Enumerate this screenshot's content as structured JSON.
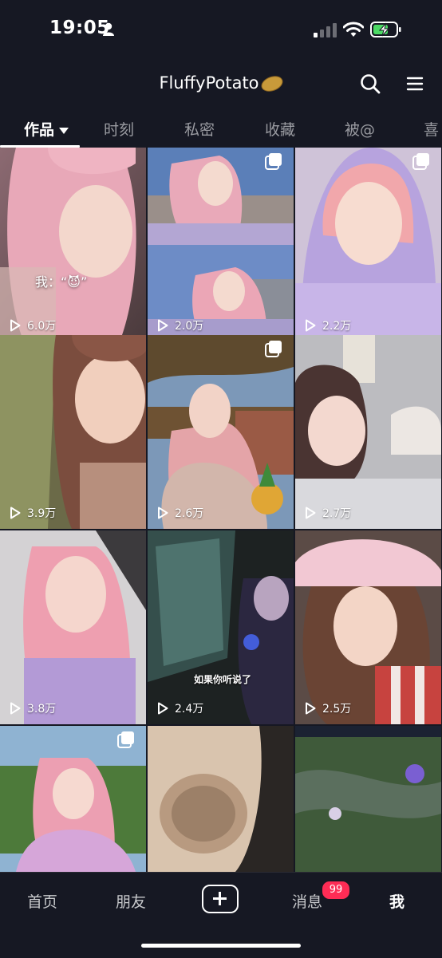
{
  "status_bar": {
    "time": "19:05"
  },
  "header": {
    "title": "FluffyPotato"
  },
  "tabs": [
    {
      "label": "作品",
      "active": true
    },
    {
      "label": "时刻"
    },
    {
      "label": "私密"
    },
    {
      "label": "收藏"
    },
    {
      "label": "被@"
    },
    {
      "label": "喜"
    }
  ],
  "grid": [
    {
      "views": "6.0万",
      "overlay": "我：“😈”"
    },
    {
      "views": "2.0万",
      "multi": true
    },
    {
      "views": "2.2万",
      "multi": true
    },
    {
      "views": "3.9万"
    },
    {
      "views": "2.6万",
      "multi": true
    },
    {
      "views": "2.7万"
    },
    {
      "views": "3.8万"
    },
    {
      "views": "2.4万",
      "caption": "如果你听说了"
    },
    {
      "views": "2.5万"
    },
    {
      "views": "",
      "multi": true
    },
    {
      "views": ""
    },
    {
      "views": ""
    }
  ],
  "bottom_nav": {
    "home": "首页",
    "friends": "朋友",
    "messages": "消息",
    "messages_badge": "99",
    "me": "我"
  },
  "colors": {
    "background": "#161823",
    "badge": "#fe2c55",
    "battery": "#4cd964"
  }
}
